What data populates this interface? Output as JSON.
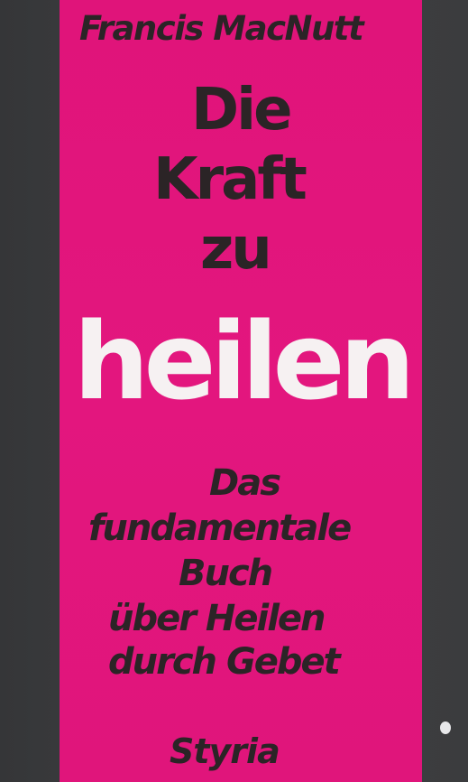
{
  "cover": {
    "author": "Francis MacNutt",
    "title_lines": [
      "Die",
      "Kraft",
      "zu"
    ],
    "title_main": "heilen",
    "subtitle_lines": [
      "Das",
      "fundamentale",
      "Buch",
      "über Heilen",
      "durch Gebet"
    ],
    "publisher": "Styria"
  },
  "colors": {
    "background": "#3a3b3d",
    "panel": "#e0147a",
    "dark_text": "#2b2426",
    "light_text": "#f6f1f2"
  }
}
